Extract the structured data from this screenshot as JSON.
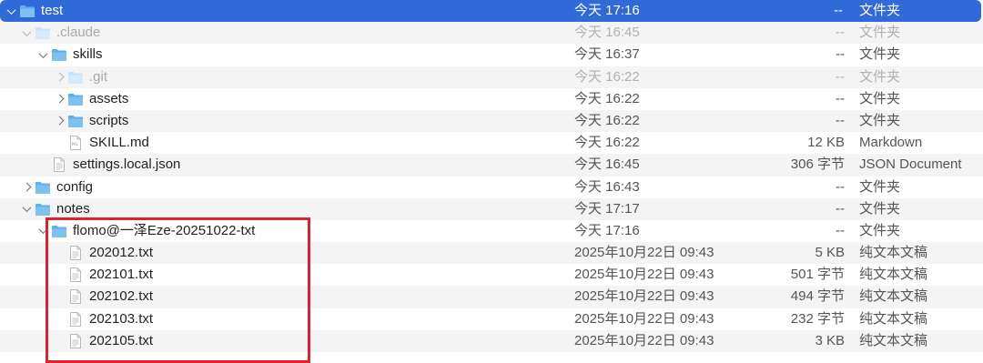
{
  "rows": [
    {
      "name": "test",
      "date": "今天 17:16",
      "size": "--",
      "kind": "文件夹",
      "level": 0,
      "type": "folder",
      "expanded": true,
      "state": "selected"
    },
    {
      "name": ".claude",
      "date": "今天 16:45",
      "size": "--",
      "kind": "文件夹",
      "level": 1,
      "type": "folder",
      "expanded": true,
      "state": "dim"
    },
    {
      "name": "skills",
      "date": "今天 16:37",
      "size": "--",
      "kind": "文件夹",
      "level": 2,
      "type": "folder",
      "expanded": true,
      "state": "normal"
    },
    {
      "name": ".git",
      "date": "今天 16:22",
      "size": "--",
      "kind": "文件夹",
      "level": 3,
      "type": "folder",
      "expanded": false,
      "state": "dim"
    },
    {
      "name": "assets",
      "date": "今天 16:22",
      "size": "--",
      "kind": "文件夹",
      "level": 3,
      "type": "folder",
      "expanded": false,
      "state": "normal"
    },
    {
      "name": "scripts",
      "date": "今天 16:22",
      "size": "--",
      "kind": "文件夹",
      "level": 3,
      "type": "folder",
      "expanded": false,
      "state": "normal"
    },
    {
      "name": "SKILL.md",
      "date": "今天 16:22",
      "size": "12 KB",
      "kind": "Markdown",
      "level": 3,
      "type": "md",
      "state": "normal"
    },
    {
      "name": "settings.local.json",
      "date": "今天 16:45",
      "size": "306 字节",
      "kind": "JSON Document",
      "level": 2,
      "type": "file",
      "state": "normal"
    },
    {
      "name": "config",
      "date": "今天 16:43",
      "size": "--",
      "kind": "文件夹",
      "level": 1,
      "type": "folder",
      "expanded": false,
      "state": "normal"
    },
    {
      "name": "notes",
      "date": "今天 17:17",
      "size": "--",
      "kind": "文件夹",
      "level": 1,
      "type": "folder",
      "expanded": true,
      "state": "normal"
    },
    {
      "name": "flomo@一泽Eze-20251022-txt",
      "date": "今天 17:16",
      "size": "--",
      "kind": "文件夹",
      "level": 2,
      "type": "folder",
      "expanded": true,
      "state": "normal"
    },
    {
      "name": "202012.txt",
      "date": "2025年10月22日 09:43",
      "size": "5 KB",
      "kind": "纯文本文稿",
      "level": 3,
      "type": "file",
      "state": "normal"
    },
    {
      "name": "202101.txt",
      "date": "2025年10月22日 09:43",
      "size": "501 字节",
      "kind": "纯文本文稿",
      "level": 3,
      "type": "file",
      "state": "normal"
    },
    {
      "name": "202102.txt",
      "date": "2025年10月22日 09:43",
      "size": "494 字节",
      "kind": "纯文本文稿",
      "level": 3,
      "type": "file",
      "state": "normal"
    },
    {
      "name": "202103.txt",
      "date": "2025年10月22日 09:43",
      "size": "232 字节",
      "kind": "纯文本文稿",
      "level": 3,
      "type": "file",
      "state": "normal"
    },
    {
      "name": "202105.txt",
      "date": "2025年10月22日 09:43",
      "size": "3 KB",
      "kind": "纯文本文稿",
      "level": 3,
      "type": "file",
      "state": "normal"
    }
  ],
  "colors": {
    "selection": "#2f6ad8",
    "folder": "#5fb0ea",
    "highlight_border": "#e0202a"
  }
}
